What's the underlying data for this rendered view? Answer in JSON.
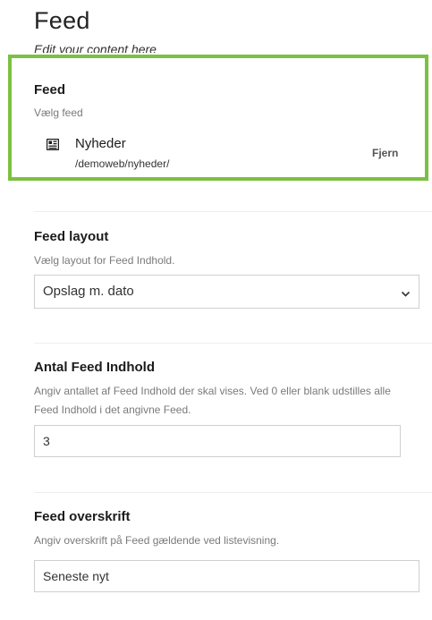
{
  "header": {
    "title": "Feed",
    "subtitle": "Edit your content here"
  },
  "feed_property": {
    "label": "Feed",
    "description": "Vælg feed",
    "selected_item": {
      "icon": "newspaper-icon",
      "name": "Nyheder",
      "path": "/demoweb/nyheder/"
    },
    "remove_label": "Fjern",
    "highlight_color": "#7cc043"
  },
  "feed_layout": {
    "label": "Feed layout",
    "description": "Vælg layout for Feed Indhold.",
    "selected_value": "Opslag m. dato"
  },
  "feed_count": {
    "label": "Antal Feed Indhold",
    "description_line1": "Angiv antallet af Feed Indhold der skal vises. Ved 0 eller blank udstilles alle",
    "description_line2": "Feed Indhold i det angivne Feed.",
    "value": "3"
  },
  "feed_heading": {
    "label": "Feed overskrift",
    "description": "Angiv overskrift på Feed gældende ved listevisning.",
    "value": "Seneste nyt"
  }
}
